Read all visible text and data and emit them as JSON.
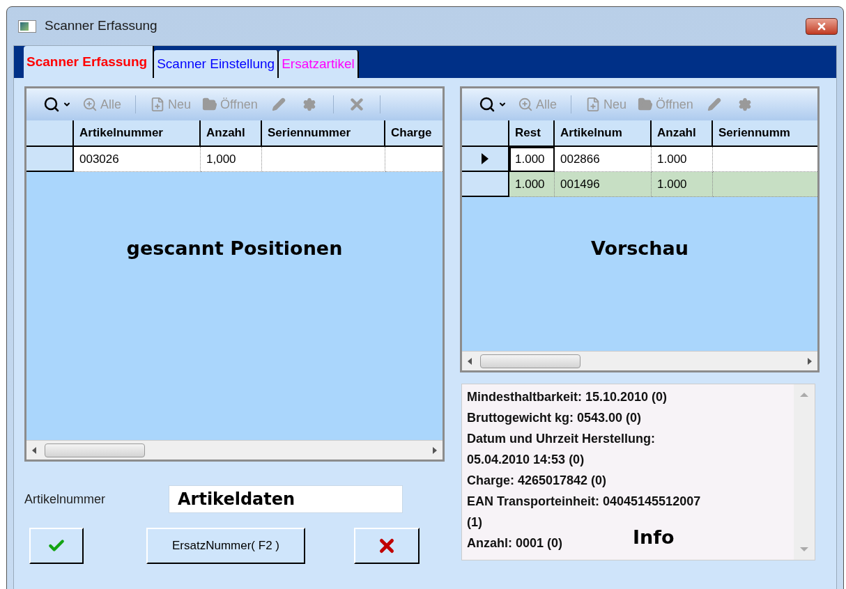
{
  "window": {
    "title": "Scanner Erfassung"
  },
  "tabs": [
    {
      "label": "Scanner Erfassung",
      "selected": true,
      "color": "#ff0000"
    },
    {
      "label": "Scanner Einstellung",
      "selected": false,
      "color": "#0000ff"
    },
    {
      "label": "Ersatzartikel",
      "selected": false,
      "color": "#ff00ff"
    }
  ],
  "left_grid": {
    "toolbar": [
      {
        "kind": "search"
      },
      {
        "kind": "zoom",
        "label": "Alle"
      },
      {
        "kind": "separator"
      },
      {
        "kind": "new",
        "label": "Neu"
      },
      {
        "kind": "open",
        "label": "Öffnen"
      },
      {
        "kind": "edit"
      },
      {
        "kind": "settings"
      },
      {
        "kind": "separator"
      },
      {
        "kind": "delete"
      },
      {
        "kind": "separator"
      }
    ],
    "columns": [
      "Artikelnummer",
      "Anzahl",
      "Seriennummer",
      "Charge"
    ],
    "rows": [
      {
        "current": false,
        "highlighted": false,
        "cells": [
          "003026",
          "1,000",
          "",
          ""
        ]
      }
    ],
    "annotation": "gescannt Positionen"
  },
  "right_grid": {
    "toolbar": [
      {
        "kind": "search"
      },
      {
        "kind": "zoom",
        "label": "Alle"
      },
      {
        "kind": "separator"
      },
      {
        "kind": "new",
        "label": "Neu"
      },
      {
        "kind": "open",
        "label": "Öffnen"
      },
      {
        "kind": "edit"
      },
      {
        "kind": "settings"
      }
    ],
    "columns": [
      "Rest",
      "Artikelnum",
      "Anzahl",
      "Seriennumm"
    ],
    "rows": [
      {
        "current": true,
        "highlighted": false,
        "cells": [
          "1.000",
          "002866",
          "1.000",
          ""
        ]
      },
      {
        "current": false,
        "highlighted": true,
        "cells": [
          "1.000",
          "001496",
          "1.000",
          ""
        ]
      }
    ],
    "annotation": "Vorschau"
  },
  "article_field": {
    "label": "Artikelnummer",
    "value": "Artikeldaten"
  },
  "buttons": [
    {
      "kind": "confirm"
    },
    {
      "kind": "text",
      "label": "ErsatzNummer( F2 )"
    },
    {
      "kind": "cancel"
    }
  ],
  "info": {
    "lines": [
      "Mindesthaltbarkeit: 15.10.2010 (0)",
      "Bruttogewicht kg: 0543.00 (0)",
      "Datum und Uhrzeit Herstellung:",
      "05.04.2010 14:53 (0)",
      "Charge: 4265017842 (0)",
      "EAN Transporteinheit: 04045145512007",
      "(1)",
      "Anzahl: 0001 (0)"
    ],
    "annotation": "Info"
  }
}
